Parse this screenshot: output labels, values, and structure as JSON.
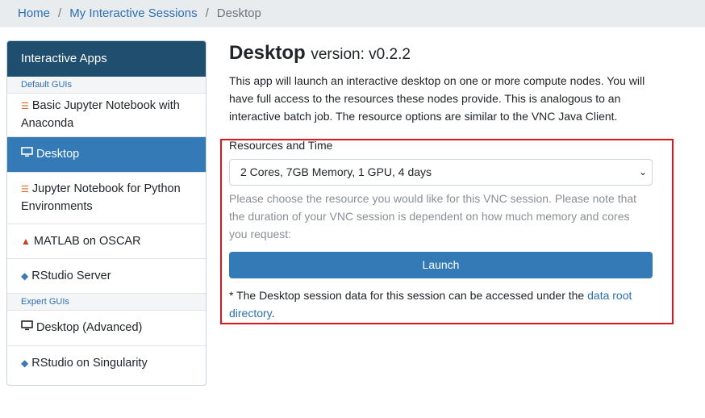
{
  "breadcrumb": {
    "home": "Home",
    "sessions": "My Interactive Sessions",
    "current": "Desktop",
    "separator": "/"
  },
  "sidebar": {
    "header": "Interactive Apps",
    "default_label": "Default GUIs",
    "expert_label": "Expert GUIs",
    "items": [
      {
        "icon": "jupyter-icon",
        "label": "Basic Jupyter Notebook with Anaconda"
      },
      {
        "icon": "monitor-icon",
        "label": "Desktop",
        "active": true
      },
      {
        "icon": "jupyter-icon",
        "label": "Jupyter Notebook for Python Environments"
      },
      {
        "icon": "matlab-icon",
        "label": "MATLAB on OSCAR"
      },
      {
        "icon": "rstudio-icon",
        "label": "RStudio Server"
      }
    ],
    "expert_items": [
      {
        "icon": "monitor-icon",
        "label": "Desktop (Advanced)"
      },
      {
        "icon": "rstudio-icon",
        "label": "RStudio on Singularity"
      }
    ]
  },
  "main": {
    "title": "Desktop",
    "version": "version: v0.2.2",
    "description": "This app will launch an interactive desktop on one or more compute nodes. You will have full access to the resources these nodes provide. This is analogous to an interactive batch job. The resource options are similar to the VNC Java Client.",
    "form": {
      "label": "Resources and Time",
      "selected": "2 Cores, 7GB Memory, 1 GPU, 4 days",
      "help": "Please choose the resource you would like for this VNC session. Please note that the duration of your VNC session is dependent on how much memory and cores you request:",
      "launch_label": "Launch"
    },
    "note_prefix": "* The Desktop session data for this session can be accessed under the ",
    "note_link": "data root directory",
    "note_suffix": "."
  },
  "colors": {
    "sidebar_header": "#1f4e6e",
    "accent": "#337ab7",
    "link": "#2c6fb2",
    "highlight_box": "#e3131b"
  }
}
